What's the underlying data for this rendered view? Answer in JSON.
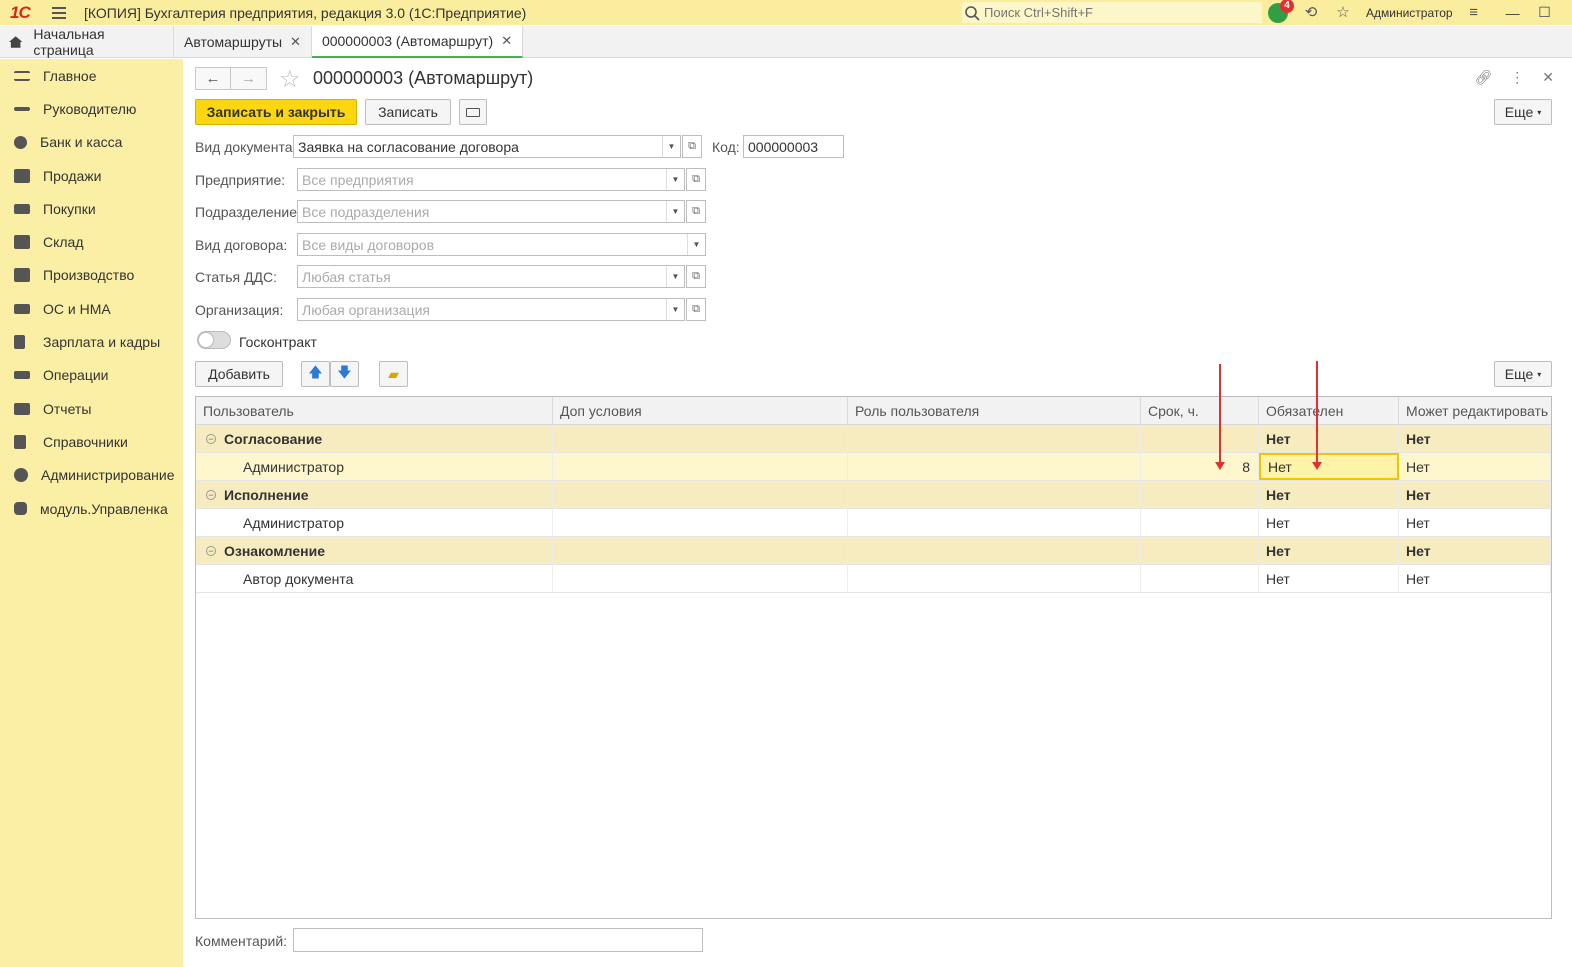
{
  "titlebar": {
    "logo": "1С",
    "title": "[КОПИЯ] Бухгалтерия предприятия, редакция 3.0  (1С:Предприятие)",
    "search_placeholder": "Поиск Ctrl+Shift+F",
    "notifications_count": "4",
    "user": "Администратор"
  },
  "tabs": [
    {
      "label": "Начальная страница"
    },
    {
      "label": "Автомаршруты"
    },
    {
      "label": "000000003 (Автомаршрут)"
    }
  ],
  "sidebar": {
    "items": [
      {
        "label": "Главное",
        "icon": "menu-lines-icon"
      },
      {
        "label": "Руководителю",
        "icon": "trend-icon"
      },
      {
        "label": "Банк и касса",
        "icon": "coin-icon"
      },
      {
        "label": "Продажи",
        "icon": "bag-icon"
      },
      {
        "label": "Покупки",
        "icon": "cart-icon"
      },
      {
        "label": "Склад",
        "icon": "warehouse-icon"
      },
      {
        "label": "Производство",
        "icon": "factory-icon"
      },
      {
        "label": "ОС и НМА",
        "icon": "truck-icon"
      },
      {
        "label": "Зарплата и кадры",
        "icon": "person-icon"
      },
      {
        "label": "Операции",
        "icon": "operations-icon"
      },
      {
        "label": "Отчеты",
        "icon": "bar-chart-icon"
      },
      {
        "label": "Справочники",
        "icon": "book-icon"
      },
      {
        "label": "Администрирование",
        "icon": "gear-icon"
      },
      {
        "label": "модуль.Управленка",
        "icon": "module-icon"
      }
    ]
  },
  "form": {
    "title": "000000003 (Автомаршрут)",
    "save_close": "Записать и закрыть",
    "save": "Записать",
    "more": "Еще",
    "doc_type_label": "Вид документа:",
    "doc_type_value": "Заявка на согласование договора",
    "code_label": "Код:",
    "code_value": "000000003",
    "fields": [
      {
        "label": "Предприятие:",
        "placeholder": "Все предприятия"
      },
      {
        "label": "Подразделение:",
        "placeholder": "Все подразделения"
      },
      {
        "label": "Вид договора:",
        "placeholder": "Все виды договоров"
      },
      {
        "label": "Статья ДДС:",
        "placeholder": "Любая статья"
      },
      {
        "label": "Организация:",
        "placeholder": "Любая организация"
      }
    ],
    "goskontrakt": "Госконтракт",
    "add": "Добавить",
    "comment_label": "Комментарий:"
  },
  "table": {
    "headers": [
      "Пользователь",
      "Доп условия",
      "Роль пользователя",
      "Срок, ч.",
      "Обязателен",
      "Может редактировать"
    ],
    "rows": [
      {
        "type": "group",
        "user": "Согласование",
        "cond": "",
        "role": "",
        "term": "",
        "req": "Нет",
        "edit": "Нет"
      },
      {
        "type": "item",
        "user": "Администратор",
        "cond": "",
        "role": "",
        "term": "8",
        "req": "Нет",
        "edit": "Нет"
      },
      {
        "type": "group",
        "user": "Исполнение",
        "cond": "",
        "role": "",
        "term": "",
        "req": "Нет",
        "edit": "Нет"
      },
      {
        "type": "item",
        "user": "Администратор",
        "cond": "",
        "role": "",
        "term": "",
        "req": "Нет",
        "edit": "Нет"
      },
      {
        "type": "group",
        "user": "Ознакомление",
        "cond": "",
        "role": "",
        "term": "",
        "req": "Нет",
        "edit": "Нет"
      },
      {
        "type": "item",
        "user": "Автор документа",
        "cond": "",
        "role": "",
        "term": "",
        "req": "Нет",
        "edit": "Нет"
      }
    ]
  }
}
